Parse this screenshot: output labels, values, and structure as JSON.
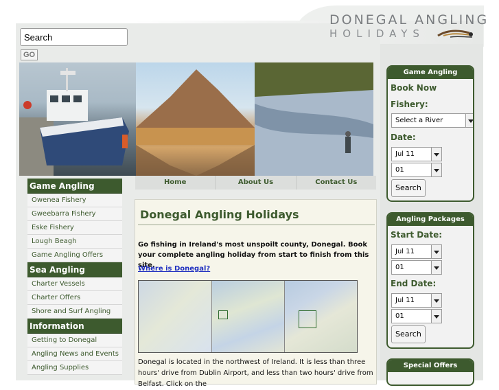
{
  "logo": {
    "line1": "DONEGAL ANGLING",
    "line2": "HOLIDAYS"
  },
  "search": {
    "value": "Search",
    "go_label": "GO"
  },
  "banner": {
    "photos": [
      "boat-photo",
      "mountain-photo",
      "river-photo"
    ]
  },
  "leftnav": {
    "sections": [
      {
        "heading": "Game Angling",
        "items": [
          "Owenea Fishery",
          "Gweebarra Fishery",
          "Eske Fishery",
          "Lough Beagh",
          "Game Angling Offers"
        ]
      },
      {
        "heading": "Sea Angling",
        "items": [
          "Charter Vessels",
          "Charter Offers",
          "Shore and Surf Angling"
        ]
      },
      {
        "heading": "Information",
        "items": [
          "Getting to Donegal",
          "Angling News and Events",
          "Angling Supplies"
        ]
      }
    ]
  },
  "topmenu": {
    "items": [
      "Home",
      "About Us",
      "Contact Us"
    ]
  },
  "content": {
    "title": "Donegal Angling Holidays",
    "intro": "Go fishing in Ireland's most unspoilt county, Donegal. Book your complete angling holiday from start to finish from this site.",
    "link": "Where is Donegal?",
    "body": "Donegal is located in the northwest of Ireland. It is less than three hours' drive from Dublin Airport, and less than two hours' drive from Belfast. Click on the"
  },
  "game_panel": {
    "heading": "Game Angling",
    "book_now": "Book Now",
    "fishery_label": "Fishery:",
    "fishery_value": "Select a River",
    "date_label": "Date:",
    "month": "Jul 11",
    "day": "01",
    "search_label": "Search"
  },
  "packages_panel": {
    "heading": "Angling Packages",
    "start_label": "Start Date:",
    "start_month": "Jul 11",
    "start_day": "01",
    "end_label": "End Date:",
    "end_month": "Jul 11",
    "end_day": "01",
    "search_label": "Search"
  },
  "offers_panel": {
    "heading": "Special Offers"
  },
  "colors": {
    "accent": "#3d5a2e",
    "link": "#2030c0",
    "content_bg": "#f6f5ea"
  }
}
